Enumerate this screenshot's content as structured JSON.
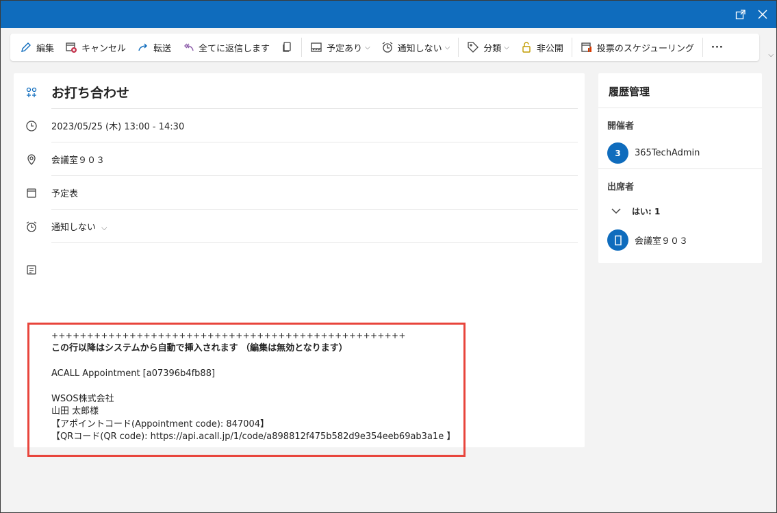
{
  "toolbar": {
    "edit": "編集",
    "cancel": "キャンセル",
    "forward": "転送",
    "reply_all": "全てに返信します",
    "busy": "予定あり",
    "no_reminder": "通知しない",
    "categorize": "分類",
    "private": "非公開",
    "poll": "投票のスケジューリング",
    "more": "···"
  },
  "event": {
    "title": "お打ち合わせ",
    "datetime": "2023/05/25 (木) 13:00 - 14:30",
    "location": "会議室９０３",
    "calendar": "予定表",
    "reminder": "通知しない"
  },
  "body": {
    "separator": "++++++++++++++++++++++++++++++++++++++++++++++++++",
    "notice": "この行以降はシステムから自動で挿入されます （編集は無効となります）",
    "appointment": "ACALL Appointment [a07396b4fb88]",
    "company": "WSOS株式会社",
    "person": "山田 太郎様",
    "code": "【アポイントコード(Appointment code): 847004】",
    "qr": "【QRコード(QR code): https://api.acall.jp/1/code/a898812f475b582d9e354eeb69ab3a1e 】"
  },
  "tracking": {
    "title": "履歴管理",
    "organizer_label": "開催者",
    "organizer_initial": "3",
    "organizer_name": "365TechAdmin",
    "attendees_label": "出席者",
    "yes_count": "はい: 1",
    "attendee_name": "会議室９０３"
  },
  "colors": {
    "titlebar": "#0f6cbd",
    "highlight_box": "#e8453c",
    "avatar": "#0f6cbd"
  }
}
